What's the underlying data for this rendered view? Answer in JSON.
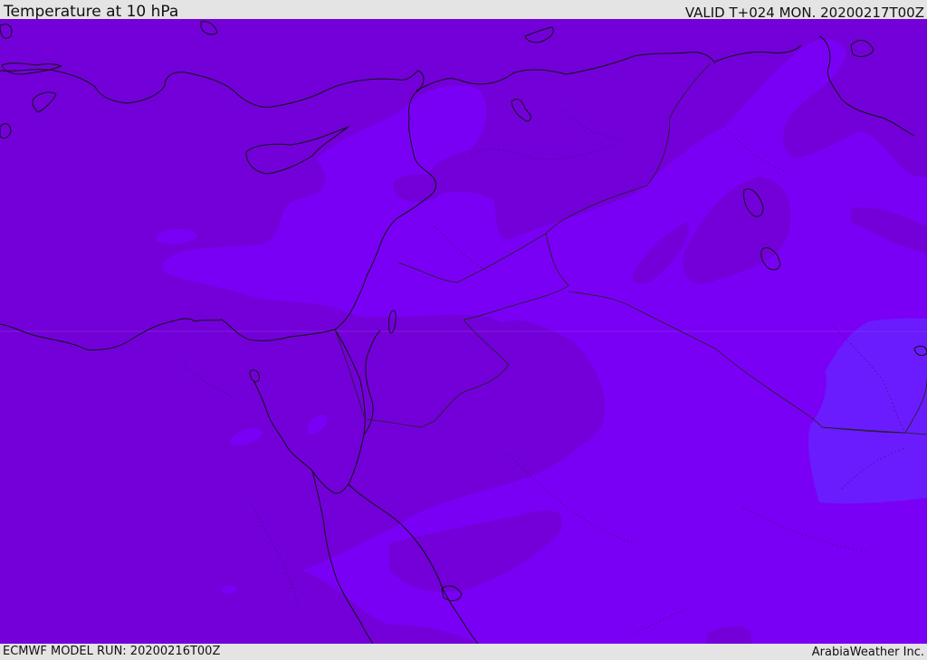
{
  "header": {
    "title": "Temperature at 10 hPa",
    "valid": "VALID T+024 MON. 20200217T00Z"
  },
  "footer": {
    "model_run": "ECMWF MODEL RUN: 20200216T00Z",
    "credit": "ArabiaWeather Inc."
  },
  "map": {
    "colors": {
      "dark_band": "#7300d9",
      "mid_band": "#7a00f5",
      "light_band": "#6a1cff",
      "coastline": "#111111",
      "border": "#222222"
    }
  }
}
